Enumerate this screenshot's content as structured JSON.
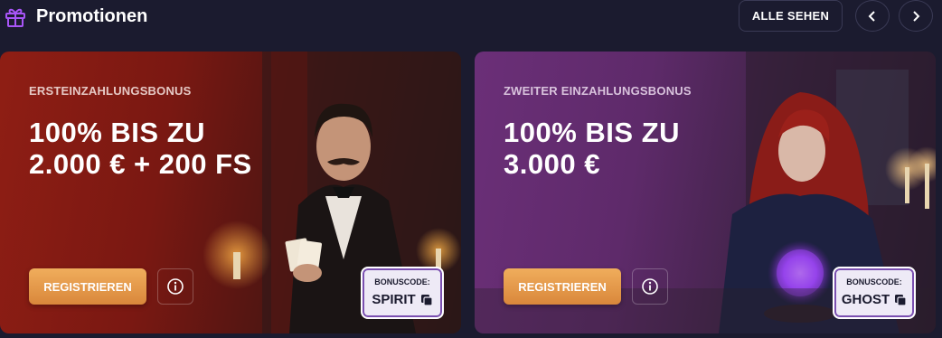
{
  "header": {
    "title": "Promotionen",
    "see_all_label": "ALLE SEHEN",
    "icons": {
      "title": "gift-icon",
      "prev": "chevron-left-icon",
      "next": "chevron-right-icon"
    }
  },
  "promotions": [
    {
      "label": "ERSTEINZAHLUNGSBONUS",
      "offer": "100% BIS ZU\n2.000 € + 200 FS",
      "register_label": "REGISTRIEREN",
      "bonus_code_label": "BONUSCODE:",
      "bonus_code": "SPIRIT",
      "accent_color": "#8f1e14"
    },
    {
      "label": "ZWEITER EINZAHLUNGSBONUS",
      "offer": "100% BIS ZU\n3.000 €",
      "register_label": "REGISTRIEREN",
      "bonus_code_label": "BONUSCODE:",
      "bonus_code": "GHOST",
      "accent_color": "#6b2f78"
    }
  ],
  "colors": {
    "background": "#1b1b2f",
    "register_button": "#e89a4a",
    "gift_icon": "#a855f7"
  }
}
